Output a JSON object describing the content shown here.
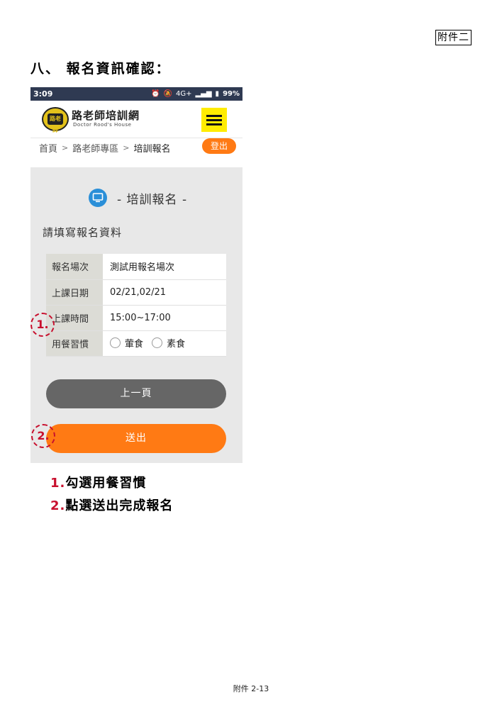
{
  "appendix_label": "附件二",
  "section_title": "八、 報名資訊確認：",
  "phone": {
    "status": {
      "time": "3:09",
      "network": "4G+",
      "battery": "99%"
    },
    "brand": {
      "name": "路老師培訓網",
      "subtitle": "Doctor Rood's House",
      "badge_text": "路老師"
    },
    "breadcrumb": {
      "home": "首頁",
      "sep": ">",
      "section": "路老師專區",
      "current": "培訓報名"
    },
    "logout_label": "登出",
    "form_title": "- 培訓報名 -",
    "prompt": "請填寫報名資料",
    "rows": [
      {
        "label": "報名場次",
        "value": "測試用報名場次"
      },
      {
        "label": "上課日期",
        "value": "02/21,02/21"
      },
      {
        "label": "上課時間",
        "value": "15:00~17:00"
      },
      {
        "label": "用餐習慣",
        "options": [
          "葷食",
          "素食"
        ]
      }
    ],
    "prev_label": "上一頁",
    "submit_label": "送出"
  },
  "markers": [
    "1.",
    "2."
  ],
  "steps": [
    {
      "num": "1.",
      "text": "勾選用餐習慣"
    },
    {
      "num": "2.",
      "text": "點選送出完成報名"
    }
  ],
  "footer": "附件 2-13",
  "colors": {
    "accent_orange": "#ff7a14",
    "menu_yellow": "#ffec00",
    "marker_red": "#c8102e"
  }
}
